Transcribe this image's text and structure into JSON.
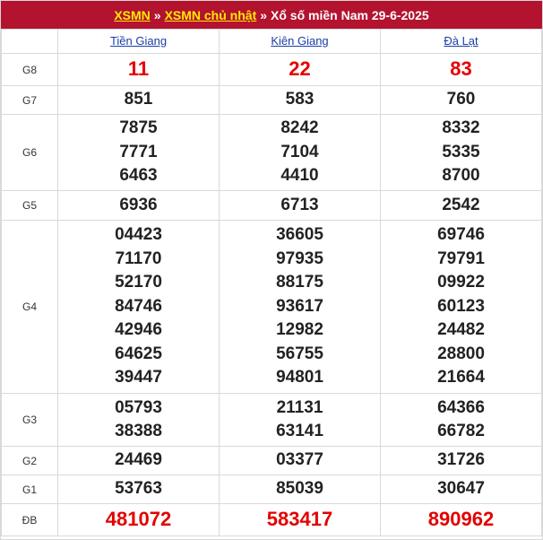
{
  "header": {
    "link1": "XSMN",
    "sep1": "»",
    "link2": "XSMN chủ nhật",
    "sep2": "»",
    "title": "Xổ số miền Nam 29-6-2025"
  },
  "provinces": [
    "Tiền Giang",
    "Kiên Giang",
    "Đà Lạt"
  ],
  "prizes": [
    {
      "label": "G8",
      "values": [
        [
          "11"
        ],
        [
          "22"
        ],
        [
          "83"
        ]
      ],
      "highlight": true
    },
    {
      "label": "G7",
      "values": [
        [
          "851"
        ],
        [
          "583"
        ],
        [
          "760"
        ]
      ]
    },
    {
      "label": "G6",
      "values": [
        [
          "7875",
          "7771",
          "6463"
        ],
        [
          "8242",
          "7104",
          "4410"
        ],
        [
          "8332",
          "5335",
          "8700"
        ]
      ]
    },
    {
      "label": "G5",
      "values": [
        [
          "6936"
        ],
        [
          "6713"
        ],
        [
          "2542"
        ]
      ]
    },
    {
      "label": "G4",
      "values": [
        [
          "04423",
          "71170",
          "52170",
          "84746",
          "42946",
          "64625",
          "39447"
        ],
        [
          "36605",
          "97935",
          "88175",
          "93617",
          "12982",
          "56755",
          "94801"
        ],
        [
          "69746",
          "79791",
          "09922",
          "60123",
          "24482",
          "28800",
          "21664"
        ]
      ]
    },
    {
      "label": "G3",
      "values": [
        [
          "05793",
          "38388"
        ],
        [
          "21131",
          "63141"
        ],
        [
          "64366",
          "66782"
        ]
      ]
    },
    {
      "label": "G2",
      "values": [
        [
          "24469"
        ],
        [
          "03377"
        ],
        [
          "31726"
        ]
      ]
    },
    {
      "label": "G1",
      "values": [
        [
          "53763"
        ],
        [
          "85039"
        ],
        [
          "30647"
        ]
      ]
    },
    {
      "label": "ĐB",
      "values": [
        [
          "481072"
        ],
        [
          "583417"
        ],
        [
          "890962"
        ]
      ],
      "highlight": true
    }
  ],
  "colors": {
    "header_bg": "#b3132f",
    "link_yellow": "#ffea00",
    "highlight_red": "#e40000",
    "province_blue": "#1a3da8"
  }
}
